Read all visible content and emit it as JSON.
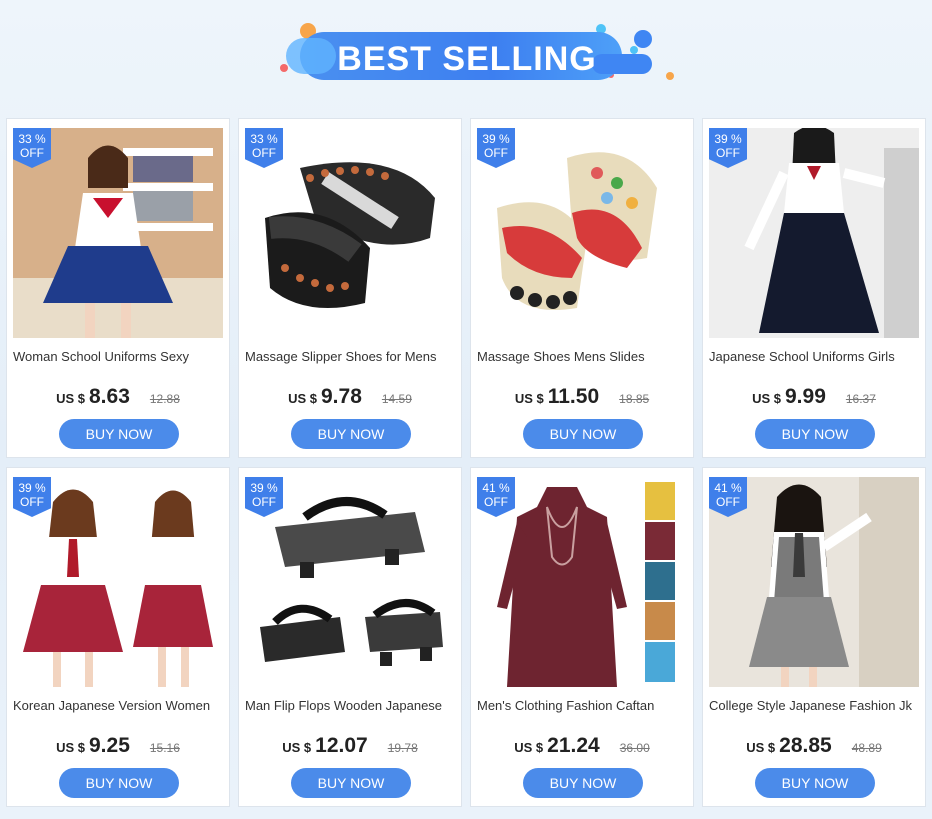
{
  "header": {
    "title": "BEST SELLING"
  },
  "products": [
    {
      "discount": "33 %",
      "off": "OFF",
      "title": "Woman School Uniforms Sexy",
      "currency": "US $",
      "price": "8.63",
      "old_price": "12.88",
      "button": "BUY NOW"
    },
    {
      "discount": "33 %",
      "off": "OFF",
      "title": "Massage Slipper Shoes for Mens",
      "currency": "US $",
      "price": "9.78",
      "old_price": "14.59",
      "button": "BUY NOW"
    },
    {
      "discount": "39 %",
      "off": "OFF",
      "title": "Massage Shoes Mens Slides",
      "currency": "US $",
      "price": "11.50",
      "old_price": "18.85",
      "button": "BUY NOW"
    },
    {
      "discount": "39 %",
      "off": "OFF",
      "title": "Japanese School Uniforms Girls",
      "currency": "US $",
      "price": "9.99",
      "old_price": "16.37",
      "button": "BUY NOW"
    },
    {
      "discount": "39 %",
      "off": "OFF",
      "title": "Korean Japanese Version Women",
      "currency": "US $",
      "price": "9.25",
      "old_price": "15.16",
      "button": "BUY NOW"
    },
    {
      "discount": "39 %",
      "off": "OFF",
      "title": "Man Flip Flops Wooden Japanese",
      "currency": "US $",
      "price": "12.07",
      "old_price": "19.78",
      "button": "BUY NOW"
    },
    {
      "discount": "41 %",
      "off": "OFF",
      "title": "Men's Clothing Fashion Caftan",
      "currency": "US $",
      "price": "21.24",
      "old_price": "36.00",
      "button": "BUY NOW"
    },
    {
      "discount": "41 %",
      "off": "OFF",
      "title": "College Style Japanese Fashion Jk",
      "currency": "US $",
      "price": "28.85",
      "old_price": "48.89",
      "button": "BUY NOW"
    }
  ],
  "colors": {
    "accent": "#4b8bea",
    "badge": "#3f7fea"
  }
}
